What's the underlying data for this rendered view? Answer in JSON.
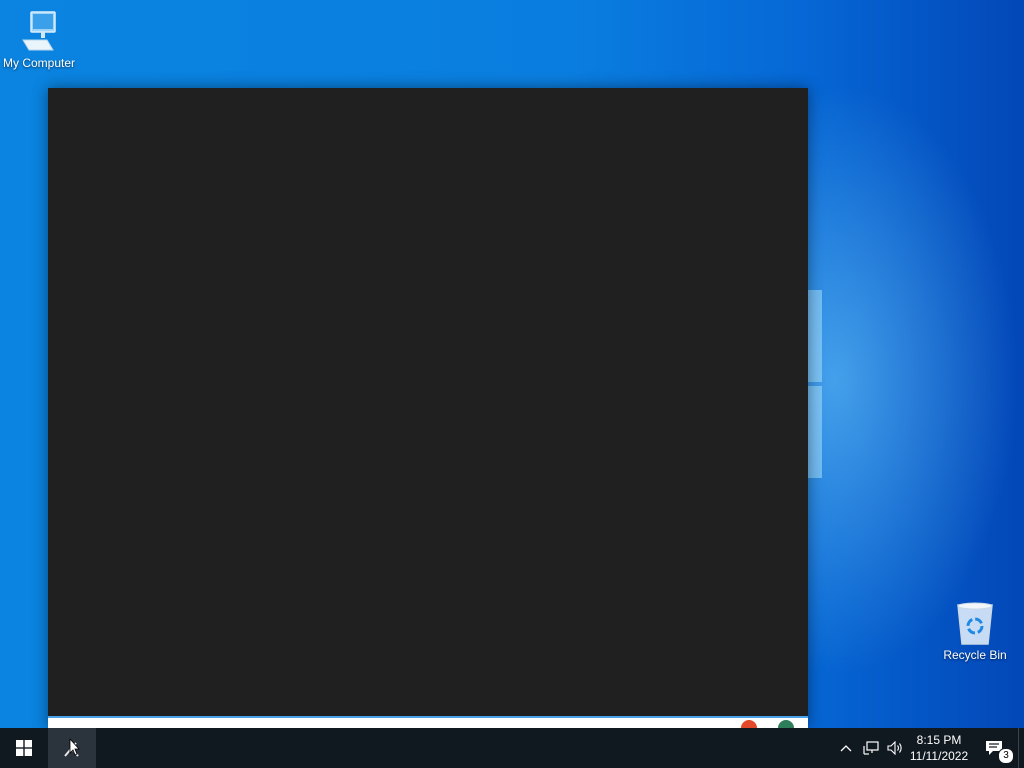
{
  "desktop": {
    "icons": [
      {
        "label": "My Computer",
        "icon": "computer-icon"
      },
      {
        "label": "Recycle Bin",
        "icon": "recycle-bin-icon"
      }
    ]
  },
  "window": {
    "theme": "#202020",
    "content": ""
  },
  "taskbar": {
    "start_icon": "windows-logo-icon",
    "pinned": [
      {
        "icon": "app-icon",
        "active": true
      }
    ],
    "tray": {
      "overflow_icon": "chevron-up-icon",
      "network_icon": "network-icon",
      "volume_icon": "volume-icon",
      "time": "8:15 PM",
      "date": "11/11/2022",
      "notifications_icon": "notification-icon",
      "notification_count": "3"
    }
  },
  "colors": {
    "accent": "#0a7ee0",
    "taskbar": "#101820"
  }
}
